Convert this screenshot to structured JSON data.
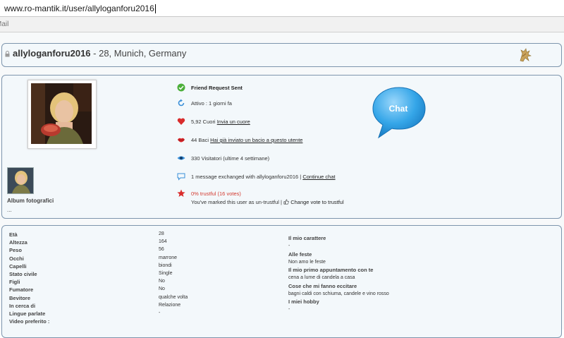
{
  "browser": {
    "url": "www.ro-mantik.it/user/allyloganforu2016",
    "toolbar_item": "Mail"
  },
  "header": {
    "username": "allyloganforu2016",
    "subtitle": " - 28, Munich, Germany"
  },
  "profile": {
    "album_label": "Album fotografici",
    "album_dash": "...",
    "friend_request": "Friend Request Sent",
    "active": "Attivo : 1 giorni fa",
    "hearts_text": "5,92 Cuori ",
    "hearts_link": "Invia un cuore",
    "kisses_text": "44 Baci ",
    "kisses_link": "Hai già inviato un bacio a questo utente",
    "visitors": "330 Visitatori (ultime 4 settimane)",
    "messages_text": "1 message exchanged with allyloganforu2016 | ",
    "messages_link": "Continue chat",
    "trust": "0% trustful (16 votes)",
    "marked_text": "You've marked this user as un-trustful | ",
    "change_vote": "Change vote to trustful",
    "chat_label": "Chat"
  },
  "details": {
    "rows": [
      {
        "label": "Età",
        "value": "28"
      },
      {
        "label": "Altezza",
        "value": "164"
      },
      {
        "label": "Peso",
        "value": "56"
      },
      {
        "label": "Occhi",
        "value": "marrone"
      },
      {
        "label": "Capelli",
        "value": "biondi"
      },
      {
        "label": "Stato civile",
        "value": "Single"
      },
      {
        "label": "Figli",
        "value": "No"
      },
      {
        "label": "Fumatore",
        "value": "No"
      },
      {
        "label": "Bevitore",
        "value": "qualche volta"
      },
      {
        "label": "In cerca di",
        "value": "Relazione"
      },
      {
        "label": "Lingue parlate",
        "value": "-"
      },
      {
        "label": "Video preferito :",
        "value": ""
      }
    ],
    "right": [
      {
        "label": "Il mio carattere",
        "value": "-"
      },
      {
        "label": "Alle feste",
        "value": "Non amo le feste"
      },
      {
        "label": "Il mio primo appuntamento con te",
        "value": "cena a lume di candela a casa"
      },
      {
        "label": "Cose che mi fanno eccitare",
        "value": "bagni caldi con schiuma, candele e vino rosso"
      },
      {
        "label": "I miei hobby",
        "value": "-"
      }
    ]
  },
  "colors": {
    "panel_border": "#7d95ad",
    "panel_bg": "#f3f8fb",
    "chat_blue": "#35a6e8",
    "trust_red": "#d33b30",
    "trust_green": "#2f9a3b"
  }
}
